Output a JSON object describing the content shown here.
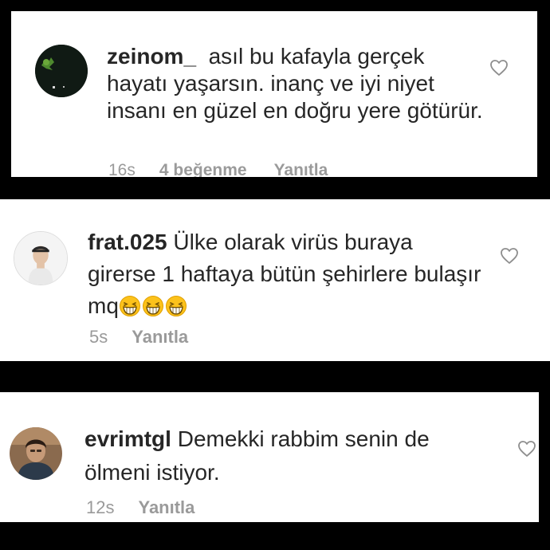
{
  "comments": [
    {
      "username": "zeinom_",
      "text": "asıl bu kafayla gerçek hayatı yaşarsın. inanç ve iyi niyet insanı en güzel en doğru yere götürür.",
      "time": "16s",
      "likes": "4 beğenme",
      "reply_label": "Yanıtla",
      "icon": "heart-outline-icon"
    },
    {
      "username": "frat.025",
      "text": "Ülke olarak virüs  buraya girerse 1 haftaya bütün şehirlere bulaşır mq",
      "emoji_count": 3,
      "emoji_icon": "grinning-squinting-face-emoji",
      "time": "5s",
      "reply_label": "Yanıtla",
      "icon": "heart-outline-icon"
    },
    {
      "username": "evrimtgl",
      "text": "Demekki rabbim senin de ölmeni istiyor.",
      "time": "12s",
      "reply_label": "Yanıtla",
      "icon": "heart-outline-icon"
    }
  ],
  "colors": {
    "background": "#000000",
    "card": "#ffffff",
    "text": "#262626",
    "meta": "#9a9a9a",
    "heart_stroke": "#8e8e8e"
  }
}
